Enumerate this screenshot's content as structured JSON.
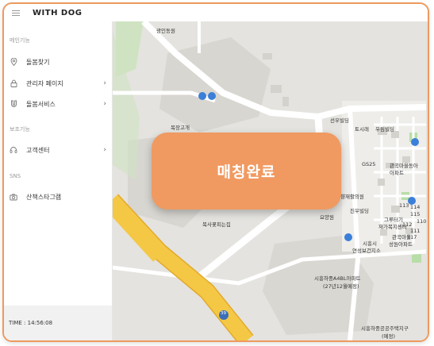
{
  "app": {
    "title": "WITH DOG"
  },
  "sidebar": {
    "sections": [
      {
        "label": "메인기능",
        "items": [
          {
            "label": "돌봄찾기",
            "icon": "map-pin-icon",
            "chevron": false
          },
          {
            "label": "관리자 페이지",
            "icon": "lock-icon",
            "chevron": true
          },
          {
            "label": "돌봄서비스",
            "icon": "magnet-icon",
            "chevron": true
          }
        ]
      },
      {
        "label": "보조기능",
        "items": [
          {
            "label": "고객센터",
            "icon": "headset-icon",
            "chevron": true
          }
        ]
      },
      {
        "label": "SNS",
        "items": [
          {
            "label": "산책스타그램",
            "icon": "camera-icon",
            "chevron": false
          }
        ]
      }
    ],
    "chevron_glyph": "›",
    "time": "TIME : 14:56:08"
  },
  "map": {
    "labels": [
      "광인동원",
      "목장고개",
      "선우빌딩",
      "토시래",
      "우림빌딩",
      "GS25",
      "관곡마을동아",
      "아파트",
      "녹향재활의원",
      "진우빌딩",
      "요양원",
      "그루터기",
      "재가복지센터",
      "시흥시",
      "연성보건지소",
      "관곡마을",
      "성원아파트",
      "복사꽃피는집",
      "시흥하중A4BL아파트",
      "(27년12월예정)",
      "시흥하중공공주택지구",
      "(예정)",
      "39",
      "거",
      "114",
      "115",
      "112",
      "111",
      "110",
      "113",
      "117"
    ]
  },
  "status": {
    "match_label": "매칭완료"
  },
  "colors": {
    "accent": "#f09a61",
    "border": "#ee9a5e",
    "road_yellow": "#f2c43d"
  }
}
